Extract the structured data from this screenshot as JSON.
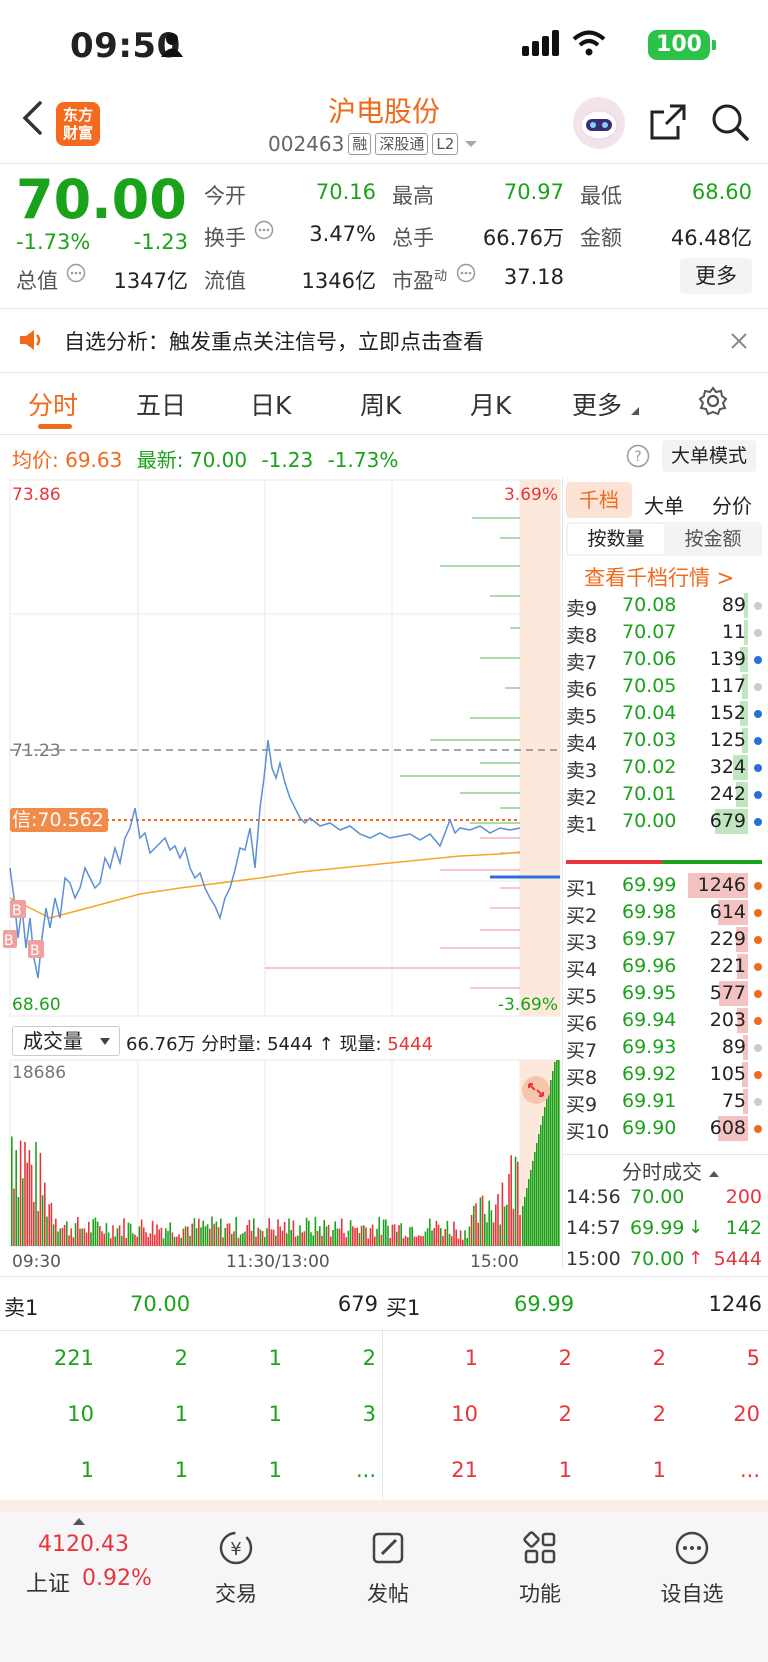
{
  "status": {
    "time": "09:50",
    "battery": "100"
  },
  "header": {
    "logo_line1": "东方",
    "logo_line2": "财富",
    "title": "沪电股份",
    "code": "002463",
    "tags": [
      "融",
      "深股通",
      "L2"
    ]
  },
  "quote": {
    "price": "70.00",
    "change_pct": "-1.73%",
    "change": "-1.23",
    "stats": [
      {
        "label": "今开",
        "value": "70.16",
        "color": "green"
      },
      {
        "label": "最高",
        "value": "70.97",
        "color": "green"
      },
      {
        "label": "最低",
        "value": "68.60",
        "color": "green"
      },
      {
        "label": "换手",
        "value": "3.47%",
        "color": "dark"
      },
      {
        "label": "总手",
        "value": "66.76万",
        "color": "dark"
      },
      {
        "label": "金额",
        "value": "46.48亿",
        "color": "dark"
      },
      {
        "label": "总值",
        "value": "1347亿",
        "color": "dark"
      },
      {
        "label": "流值",
        "value": "1346亿",
        "color": "dark"
      },
      {
        "label": "市盈",
        "value": "37.18",
        "color": "dark"
      }
    ],
    "pe_sup": "动",
    "more_label": "更多"
  },
  "banner": {
    "text": "自选分析：触发重点关注信号，立即点击查看"
  },
  "tabs": [
    "分时",
    "五日",
    "日K",
    "周K",
    "月K",
    "更多"
  ],
  "chart_head": {
    "avg_label": "均价:",
    "avg_value": "69.63",
    "latest_label": "最新:",
    "latest_value": "70.00",
    "change": "-1.23",
    "change_pct": "-1.73%",
    "big_order_mode": "大单模式"
  },
  "chart_axis": {
    "top_price": "73.86",
    "top_pct": "3.69%",
    "bottom_price": "68.60",
    "bottom_pct": "-3.69%",
    "prev_close": "71.23",
    "signal_label": "信:70.562",
    "times": [
      "09:30",
      "11:30/13:00",
      "15:00"
    ]
  },
  "volume_head": {
    "selector": "成交量",
    "total": "66.76万",
    "minute_label": "分时量:",
    "minute_value": "5444",
    "now_label": "现量:",
    "now_value": "5444",
    "max": "18686"
  },
  "orderbook": {
    "tabs": [
      "千档",
      "大单",
      "分价"
    ],
    "subtabs": [
      "按数量",
      "按金额"
    ],
    "link": "查看千档行情 >",
    "asks": [
      {
        "label": "卖9",
        "price": "70.08",
        "qty": "89",
        "bar": 0.02,
        "dot": "#cccccc"
      },
      {
        "label": "卖8",
        "price": "70.07",
        "qty": "11",
        "bar": 0.01,
        "dot": "#cccccc"
      },
      {
        "label": "卖7",
        "price": "70.06",
        "qty": "139",
        "bar": 0.05,
        "dot": "#2b6fd6"
      },
      {
        "label": "卖6",
        "price": "70.05",
        "qty": "117",
        "bar": 0.04,
        "dot": "#cccccc"
      },
      {
        "label": "卖5",
        "price": "70.04",
        "qty": "152",
        "bar": 0.05,
        "dot": "#2b6fd6"
      },
      {
        "label": "卖4",
        "price": "70.03",
        "qty": "125",
        "bar": 0.04,
        "dot": "#2b6fd6"
      },
      {
        "label": "卖3",
        "price": "70.02",
        "qty": "324",
        "bar": 0.1,
        "dot": "#2b6fd6"
      },
      {
        "label": "卖2",
        "price": "70.01",
        "qty": "242",
        "bar": 0.08,
        "dot": "#2b6fd6"
      },
      {
        "label": "卖1",
        "price": "70.00",
        "qty": "679",
        "bar": 0.22,
        "dot": "#2b6fd6"
      }
    ],
    "bids": [
      {
        "label": "买1",
        "price": "69.99",
        "qty": "1246",
        "bar": 0.4,
        "dot": "#f06a1a"
      },
      {
        "label": "买2",
        "price": "69.98",
        "qty": "614",
        "bar": 0.2,
        "dot": "#f06a1a"
      },
      {
        "label": "买3",
        "price": "69.97",
        "qty": "229",
        "bar": 0.08,
        "dot": "#f06a1a"
      },
      {
        "label": "买4",
        "price": "69.96",
        "qty": "221",
        "bar": 0.07,
        "dot": "#f06a1a"
      },
      {
        "label": "买5",
        "price": "69.95",
        "qty": "577",
        "bar": 0.19,
        "dot": "#f06a1a"
      },
      {
        "label": "买6",
        "price": "69.94",
        "qty": "203",
        "bar": 0.07,
        "dot": "#f06a1a"
      },
      {
        "label": "买7",
        "price": "69.93",
        "qty": "89",
        "bar": 0.03,
        "dot": "#cccccc"
      },
      {
        "label": "买8",
        "price": "69.92",
        "qty": "105",
        "bar": 0.04,
        "dot": "#f06a1a"
      },
      {
        "label": "买9",
        "price": "69.91",
        "qty": "75",
        "bar": 0.03,
        "dot": "#cccccc"
      },
      {
        "label": "买10",
        "price": "69.90",
        "qty": "608",
        "bar": 0.2,
        "dot": "#f06a1a"
      }
    ],
    "trades_title": "分时成交",
    "trades": [
      {
        "time": "14:56",
        "price": "70.00",
        "arrow": "",
        "qty": "200"
      },
      {
        "time": "14:57",
        "price": "69.99",
        "arrow": "↓",
        "qty": "142"
      },
      {
        "time": "15:00",
        "price": "70.00",
        "arrow": "↑",
        "qty": "5444"
      }
    ]
  },
  "bottom_stats": {
    "ask_label": "卖1",
    "ask_price": "70.00",
    "ask_qty": "679",
    "bid_label": "买1",
    "bid_price": "69.99",
    "bid_qty": "1246",
    "left_rows": [
      [
        "221",
        "2",
        "1",
        "2"
      ],
      [
        "10",
        "1",
        "1",
        "3"
      ],
      [
        "1",
        "1",
        "1",
        "..."
      ]
    ],
    "right_rows": [
      [
        "1",
        "2",
        "2",
        "5"
      ],
      [
        "10",
        "2",
        "2",
        "20"
      ],
      [
        "21",
        "1",
        "1",
        "..."
      ]
    ]
  },
  "bottom_nav": {
    "index_value": "4120.43",
    "index_name": "上证",
    "index_pct": "0.92%",
    "items": [
      "交易",
      "发帖",
      "功能",
      "设自选"
    ]
  }
}
